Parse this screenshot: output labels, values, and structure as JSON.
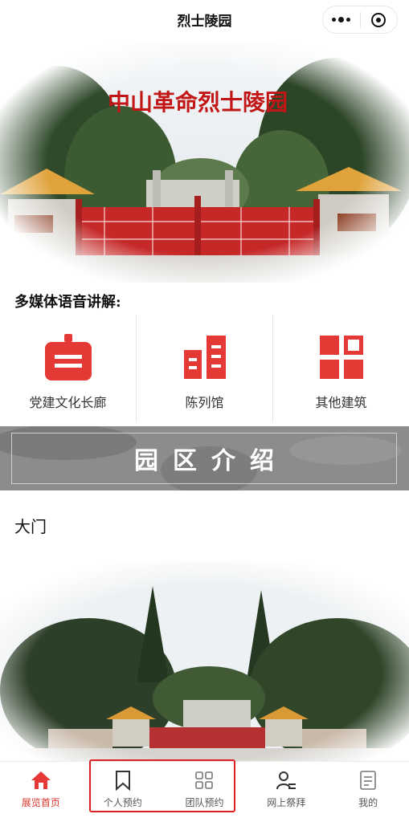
{
  "nav": {
    "title": "烈士陵园",
    "more_icon": "more-dots-icon",
    "close_icon": "target-close-icon"
  },
  "hero": {
    "gate_sign": "中山革命烈士陵园"
  },
  "multimedia": {
    "label": "多媒体语音讲解:"
  },
  "categories": [
    {
      "label": "党建文化长廊",
      "icon": "signboard-icon"
    },
    {
      "label": "陈列馆",
      "icon": "building-icon"
    },
    {
      "label": "其他建筑",
      "icon": "grid-blocks-icon"
    }
  ],
  "banner": {
    "text": "园区介绍"
  },
  "section": {
    "title": "大门"
  },
  "tabbar": {
    "items": [
      {
        "label": "展览首页",
        "icon": "home-icon",
        "active": true
      },
      {
        "label": "个人预约",
        "icon": "bookmark-icon",
        "active": false
      },
      {
        "label": "团队预约",
        "icon": "four-squares-icon",
        "active": false
      },
      {
        "label": "网上祭拜",
        "icon": "person-list-icon",
        "active": false
      },
      {
        "label": "我的",
        "icon": "document-icon",
        "active": false
      }
    ]
  },
  "colors": {
    "accent": "#e53935",
    "banner_bg": "#8c8c8c",
    "gate_red": "#c62828"
  }
}
